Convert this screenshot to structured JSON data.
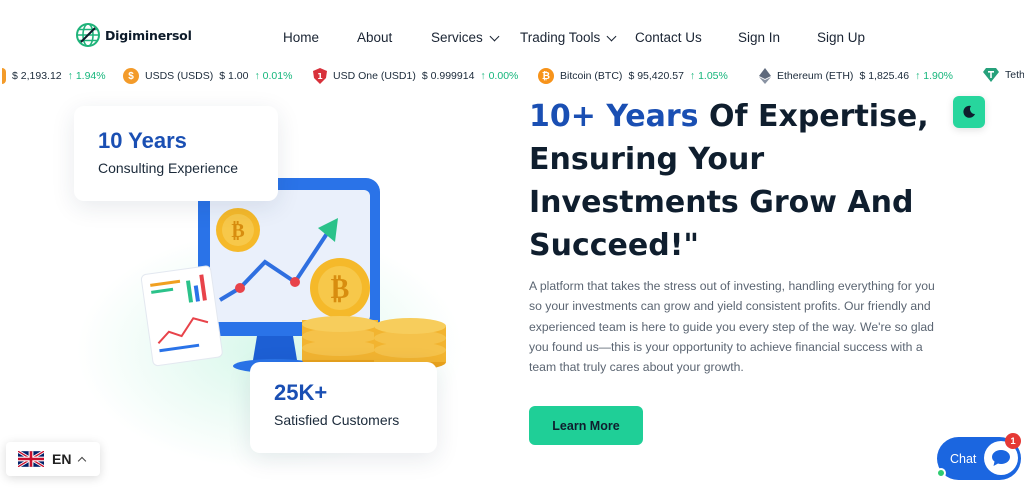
{
  "brand": {
    "name": "Digiminersol"
  },
  "nav": {
    "home": "Home",
    "about": "About",
    "services": "Services",
    "trading_tools": "Trading Tools",
    "contact": "Contact Us",
    "sign_in": "Sign In",
    "sign_up": "Sign Up"
  },
  "ticker": [
    {
      "name": "",
      "price": "$ 2,193.12",
      "change": "1.94%",
      "icon": "partial"
    },
    {
      "name": "USDS (USDS)",
      "price": "$ 1.00",
      "change": "0.01%",
      "icon": "usds-coin-icon",
      "color": "#f39b2a"
    },
    {
      "name": "USD One (USD1)",
      "price": "$ 0.999914",
      "change": "0.00%",
      "icon": "usd1-shield-icon",
      "color": "#d8313b"
    },
    {
      "name": "Bitcoin (BTC)",
      "price": "$ 95,420.57",
      "change": "1.05%",
      "icon": "bitcoin-icon",
      "color": "#f7931a"
    },
    {
      "name": "Ethereum (ETH)",
      "price": "$ 1,825.46",
      "change": "1.90%",
      "icon": "ethereum-icon",
      "color": "#5f6a7d"
    },
    {
      "name": "Teth",
      "price": "",
      "change": "",
      "icon": "tether-icon",
      "color": "#26a17b"
    }
  ],
  "stats": {
    "years": {
      "value": "10 Years",
      "label": "Consulting Experience"
    },
    "customers": {
      "value": "25K+",
      "label": "Satisfied Customers"
    }
  },
  "hero": {
    "title_highlight": "10+ Years",
    "title_rest": " Of Expertise, Ensuring Your Investments Grow And Succeed!\"",
    "description": "A platform that takes the stress out of investing, handling everything for you so your investments can grow and yield consistent profits. Our friendly and experienced team is here to guide you every step of the way. We're so glad you found us—this is your opportunity to achieve financial success with a team that truly cares about your growth.",
    "cta": "Learn More"
  },
  "language": {
    "code": "EN"
  },
  "chat": {
    "label": "Chat",
    "badge": "1"
  },
  "colors": {
    "accent": "#1fcf97",
    "brand_blue": "#1a4fb3",
    "positive": "#16b67c"
  }
}
